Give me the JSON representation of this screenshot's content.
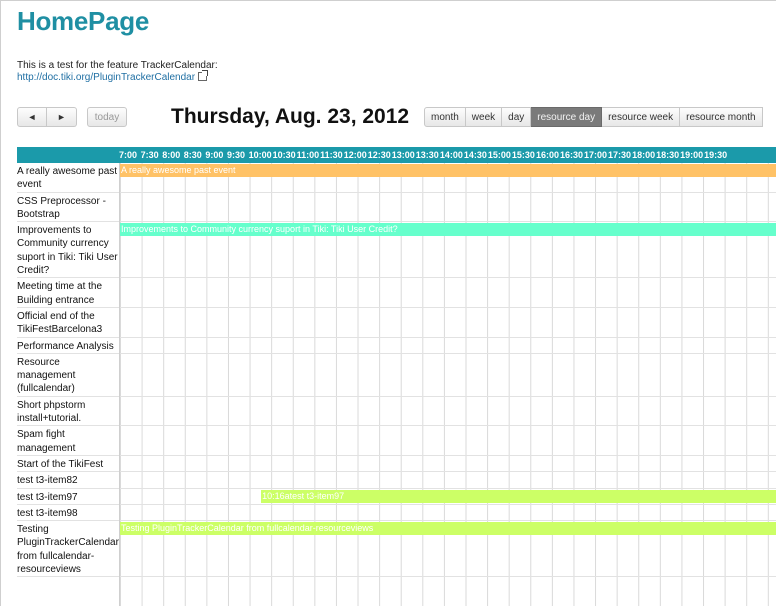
{
  "page": {
    "title": "HomePage",
    "intro": "This is a test for the feature TrackerCalendar:",
    "link_text": "http://doc.tiki.org/PluginTrackerCalendar"
  },
  "toolbar": {
    "prev_label": "◄",
    "next_label": "►",
    "today_label": "today"
  },
  "calendar": {
    "title": "Thursday, Aug. 23, 2012",
    "views": [
      "month",
      "week",
      "day",
      "resource day",
      "resource week",
      "resource month"
    ],
    "active_view": "resource day",
    "header_color": "#1b9aaa",
    "time_slots": [
      "7:00",
      "7:30",
      "8:00",
      "8:30",
      "9:00",
      "9:30",
      "10:00",
      "10:30",
      "11:00",
      "11:30",
      "12:00",
      "12:30",
      "13:00",
      "13:30",
      "14:00",
      "14:30",
      "15:00",
      "15:30",
      "16:00",
      "16:30",
      "17:00",
      "17:30",
      "18:00",
      "18:30",
      "19:00",
      "19:30"
    ],
    "resources": [
      {
        "name": "A really awesome past event",
        "lines": 2
      },
      {
        "name": "CSS Preprocessor - Bootstrap",
        "lines": 2
      },
      {
        "name": "Improvements to Community currency suport in Tiki: Tiki User Credit?",
        "lines": 4
      },
      {
        "name": "Meeting time at the Building entrance",
        "lines": 2
      },
      {
        "name": "Official end of the TikiFestBarcelona3",
        "lines": 2
      },
      {
        "name": "Performance Analysis",
        "lines": 1
      },
      {
        "name": "Resource management (fullcalendar)",
        "lines": 3
      },
      {
        "name": "Short phpstorm install+tutorial.",
        "lines": 2
      },
      {
        "name": "Spam fight management",
        "lines": 2
      },
      {
        "name": "Start of the TikiFest",
        "lines": 1
      },
      {
        "name": "test t3-item82",
        "lines": 1
      },
      {
        "name": "test t3-item97",
        "lines": 1
      },
      {
        "name": "test t3-item98",
        "lines": 1
      },
      {
        "name": "Testing PluginTrackerCalendar from fullcalendar-resourceviews",
        "lines": 4
      }
    ],
    "events": [
      {
        "resource": 0,
        "title": "A really awesome past event",
        "start": "7:00",
        "color": "#ffc266"
      },
      {
        "resource": 2,
        "title": "Improvements to Community currency suport in Tiki: Tiki User Credit?",
        "start": "7:00",
        "color": "#66ffcc"
      },
      {
        "resource": 11,
        "title": "10:16atest t3-item97",
        "start": "10:16",
        "color": "#ccff66"
      },
      {
        "resource": 13,
        "title": "Testing PluginTrackerCalendar from fullcalendar-resourceviews",
        "start": "7:00",
        "color": "#ccff66"
      }
    ]
  }
}
